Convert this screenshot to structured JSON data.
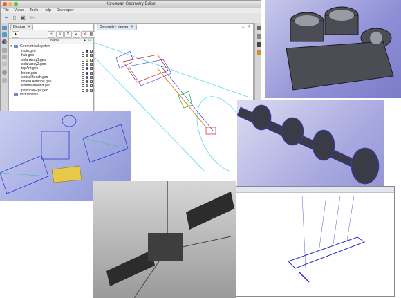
{
  "window": {
    "title": "Korolevan Geometry Editor",
    "menu": [
      "File",
      "Views",
      "Tools",
      "Help",
      "Developer"
    ]
  },
  "design_panel": {
    "tab": "Design",
    "column_name": "Name",
    "root": "Geometrical system",
    "items": [
      {
        "name": "main.geo",
        "color": "#2a2aa8"
      },
      {
        "name": "hub.geo",
        "color": "#30b030"
      },
      {
        "name": "solarArray1.geo",
        "color": "#e8d020"
      },
      {
        "name": "solarArray2.geo",
        "color": "#30b030"
      },
      {
        "name": "topAnt.geo",
        "color": "#2a2aa8"
      },
      {
        "name": "boom.geo",
        "color": "#2a2aa8"
      },
      {
        "name": "opticalBench.geo",
        "color": "#7a2fbf"
      },
      {
        "name": "dband Antenna.geo",
        "color": "#d02020"
      },
      {
        "name": "externalBound.geo",
        "color": "#30c0e0"
      },
      {
        "name": "physicalGrps.geo",
        "color": "#e08a20"
      }
    ],
    "instruments": "Instruments"
  },
  "geometry_view": {
    "tab": "Geometry viewer"
  },
  "colors": {
    "accent": "#3a78c8",
    "wire_blue": "#2a2ad0",
    "wire_cyan": "#55d8ec",
    "render_purple": "#8e8fd6"
  }
}
